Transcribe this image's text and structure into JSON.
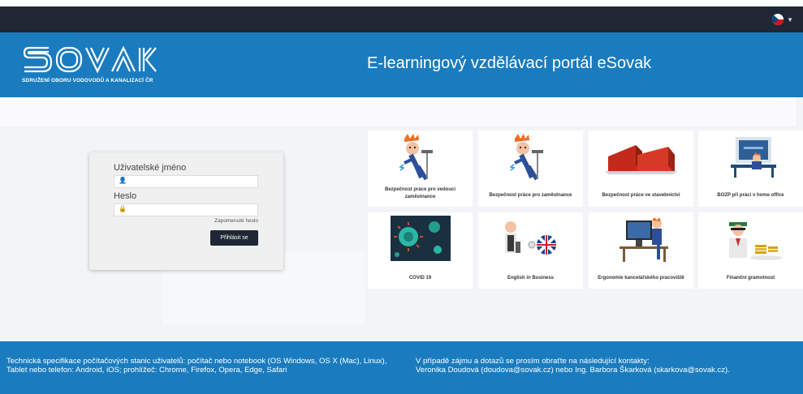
{
  "language": {
    "flag": "cz-flag-icon"
  },
  "brand": {
    "logo_text": "SOVAK",
    "subtitle": "SDRUŽENÍ OBORU VODOVODŮ A KANALIZACÍ ČR"
  },
  "header": {
    "title": "E-learningový vzdělávací portál eSovak"
  },
  "login": {
    "username_label": "Uživatelské jméno",
    "password_label": "Heslo",
    "username_value": "",
    "password_value": "",
    "forgot_label": "Zapomenuté heslo",
    "submit_label": "Přihlásit se"
  },
  "courses": [
    {
      "title": "Bezpečnost práce pro vedoucí zaměstnance",
      "icon": "worker-electric-shock-icon"
    },
    {
      "title": "Bezpečnost práce pro zaměstnance",
      "icon": "worker-electric-shock-icon"
    },
    {
      "title": "Bezpečnost práce ve stavebnictví",
      "icon": "construction-containers-icon"
    },
    {
      "title": "BOZP při práci v home office",
      "icon": "home-office-desk-icon"
    },
    {
      "title": "COVID 19",
      "icon": "virus-icon"
    },
    {
      "title": "English in Business",
      "icon": "uk-flag-businessman-icon"
    },
    {
      "title": "Ergonomie kancelářského pracoviště",
      "icon": "office-worker-computer-icon"
    },
    {
      "title": "Finanční gramotnost",
      "icon": "money-coins-icon"
    }
  ],
  "footer": {
    "left": "Technická specifikace počítačových stanic uživatelů: počítač nebo notebook (OS Windows, OS X (Mac), Linux), Tablet nebo telefon: Android, iOS; prohlížeč: Chrome, Firefox, Opera, Edge, Safari",
    "right_line1": "V případě zájmu a dotazů se prosím obraťte na následující kontakty:",
    "right_line2": "Veronika Doudová (doudova@sovak.cz) nebo Ing. Barbora Škarková (skarkova@sovak.cz)."
  },
  "colors": {
    "topbar": "#1f2734",
    "header": "#1a7cbf",
    "footer": "#1a7cbf",
    "button": "#1f2734",
    "page_bg": "#f3f4f7"
  }
}
